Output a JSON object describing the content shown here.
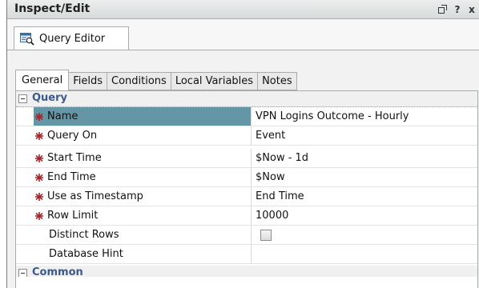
{
  "window": {
    "title": "Inspect/Edit",
    "controls": {
      "restore_icon": "restore-window-icon",
      "help_label": "?",
      "close_label": "x"
    }
  },
  "editor_tab": {
    "label": "Query Editor",
    "icon": "query-editor-icon"
  },
  "subtabs": [
    {
      "label": "General",
      "active": true
    },
    {
      "label": "Fields",
      "active": false
    },
    {
      "label": "Conditions",
      "active": false
    },
    {
      "label": "Local Variables",
      "active": false
    },
    {
      "label": "Notes",
      "active": false
    }
  ],
  "grid": {
    "sections": [
      {
        "label": "Query",
        "expanded": true
      },
      {
        "label": "Common",
        "expanded": true
      }
    ],
    "rows": [
      {
        "name": "Name",
        "value": "VPN Logins Outcome - Hourly",
        "required": true,
        "selected": true
      },
      {
        "name": "Query On",
        "value": "Event",
        "required": true,
        "selected": false
      },
      {
        "name": "Start Time",
        "value": "$Now - 1d",
        "required": true,
        "selected": false
      },
      {
        "name": "End Time",
        "value": "$Now",
        "required": true,
        "selected": false
      },
      {
        "name": "Use as Timestamp",
        "value": "End Time",
        "required": true,
        "selected": false
      },
      {
        "name": "Row Limit",
        "value": "10000",
        "required": true,
        "selected": false
      },
      {
        "name": "Distinct Rows",
        "value": "",
        "required": false,
        "selected": false,
        "checkbox": true,
        "checked": false
      },
      {
        "name": "Database Hint",
        "value": "",
        "required": false,
        "selected": false
      }
    ]
  },
  "colors": {
    "selected_row": "#6596a6",
    "section_label": "#3b5a8c",
    "required_icon": "#a3282c"
  }
}
